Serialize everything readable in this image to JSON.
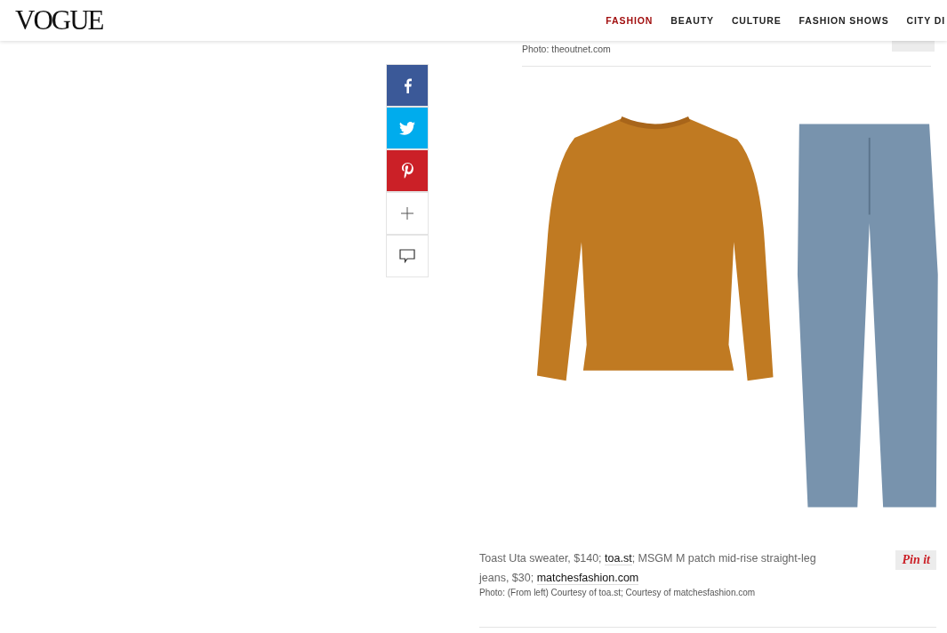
{
  "header": {
    "logo": "VOGUE",
    "nav": [
      {
        "label": "FASHION",
        "selected": true
      },
      {
        "label": "BEAUTY",
        "selected": false
      },
      {
        "label": "CULTURE",
        "selected": false
      },
      {
        "label": "FASHION SHOWS",
        "selected": false
      },
      {
        "label": "CITY DI",
        "selected": false
      }
    ]
  },
  "share_bar": [
    {
      "kind": "facebook"
    },
    {
      "kind": "twitter"
    },
    {
      "kind": "pinterest"
    },
    {
      "kind": "more"
    },
    {
      "kind": "comment"
    }
  ],
  "previous_item": {
    "photo_credit": "Photo: theoutnet.com"
  },
  "item": {
    "caption": [
      {
        "kind": "text",
        "text": "Toast Uta sweater, $140; "
      },
      {
        "kind": "link",
        "text": "toa.st"
      },
      {
        "kind": "text",
        "text": "; MSGM M patch mid-rise straight-leg jeans, $30; "
      },
      {
        "kind": "link",
        "text": "matchesfashion.com"
      }
    ],
    "photo_credit": "Photo: (From left) Courtesy of toa.st; Courtesy of matchesfashion.com",
    "pin_button": "Pin it"
  }
}
